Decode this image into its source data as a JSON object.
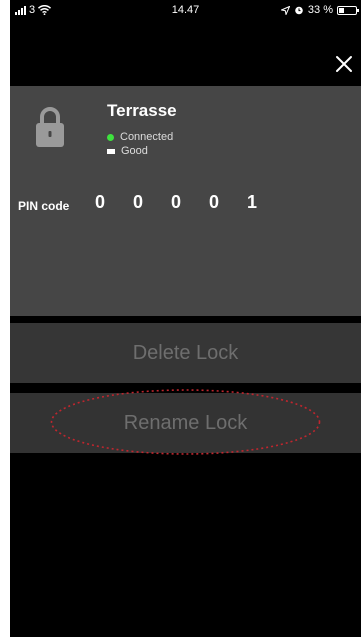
{
  "status_bar": {
    "carrier": "3",
    "time": "14.47",
    "battery_text": "33 %",
    "battery_level": 0.33
  },
  "lock": {
    "name": "Terrasse",
    "connection_status": "Connected",
    "battery_status": "Good",
    "connection_color": "#3ee23e"
  },
  "pin": {
    "label": "PIN code",
    "digits": [
      "0",
      "0",
      "0",
      "0",
      "1"
    ]
  },
  "actions": {
    "delete_label": "Delete Lock",
    "rename_label": "Rename Lock"
  },
  "icons": {
    "close": "close-icon",
    "lock": "padlock-icon"
  },
  "colors": {
    "panel": "#464646",
    "button": "#363636",
    "button_text": "#6e6e6e",
    "annotation": "#c0262e"
  }
}
